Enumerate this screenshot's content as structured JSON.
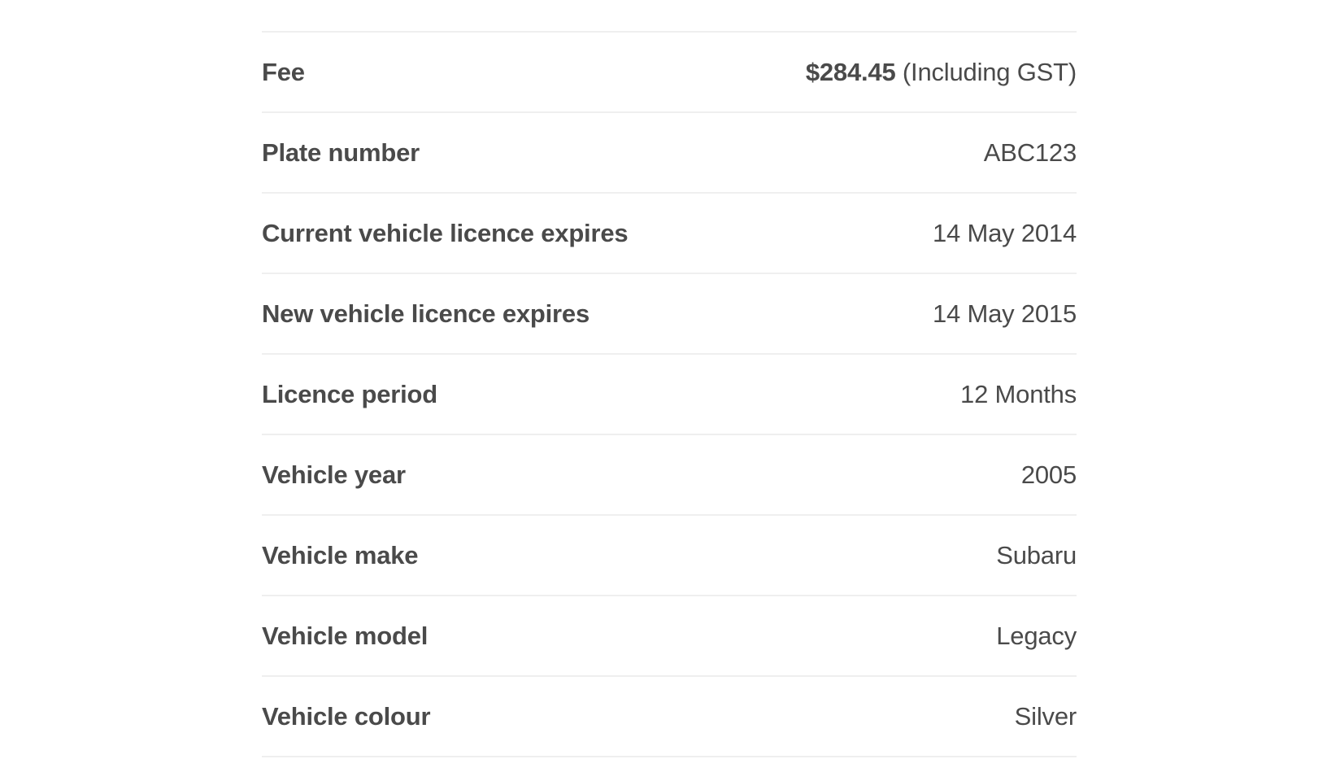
{
  "summary": {
    "rows": [
      {
        "label": "Fee",
        "amount": "$284.45",
        "note": "(Including GST)"
      },
      {
        "label": "Plate number",
        "value": "ABC123"
      },
      {
        "label": "Current vehicle licence expires",
        "value": "14 May 2014"
      },
      {
        "label": "New vehicle licence expires",
        "value": "14 May 2015"
      },
      {
        "label": "Licence period",
        "value": "12 Months"
      },
      {
        "label": "Vehicle year",
        "value": "2005"
      },
      {
        "label": "Vehicle make",
        "value": "Subaru"
      },
      {
        "label": "Vehicle model",
        "value": "Legacy"
      },
      {
        "label": "Vehicle colour",
        "value": "Silver"
      }
    ]
  },
  "colors": {
    "text": "#4a4a4a",
    "divider": "#efefef",
    "background": "#ffffff"
  }
}
